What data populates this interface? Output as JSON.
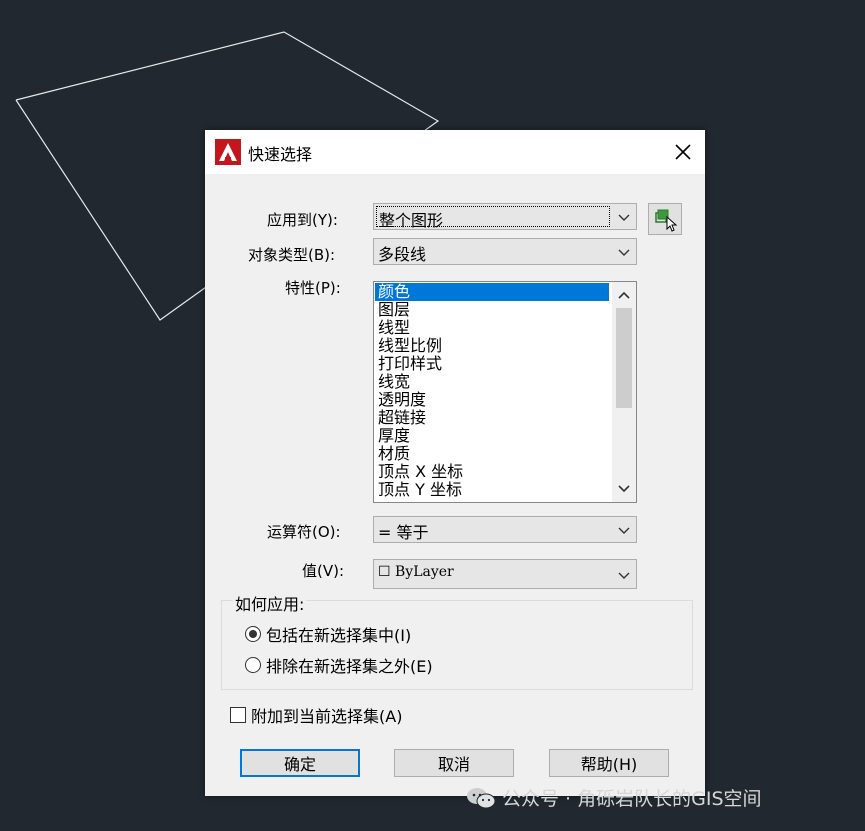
{
  "dialog": {
    "title": "快速选择",
    "close_glyph": "✕"
  },
  "form": {
    "apply_to_label": "应用到(Y):",
    "apply_to_value": "整个图形",
    "object_type_label": "对象类型(B):",
    "object_type_value": "多段线",
    "properties_label": "特性(P):",
    "properties": [
      "颜色",
      "图层",
      "线型",
      "线型比例",
      "打印样式",
      "线宽",
      "透明度",
      "超链接",
      "厚度",
      "材质",
      "顶点 X 坐标",
      "顶点 Y 坐标"
    ],
    "selected_property_index": 0,
    "operator_label": "运算符(O):",
    "operator_value": "= 等于",
    "value_label": "值(V):",
    "value_swatch": "☐",
    "value_value": "ByLayer"
  },
  "how_to_apply": {
    "title": "如何应用:",
    "include_label": "包括在新选择集中(I)",
    "exclude_label": "排除在新选择集之外(E)",
    "selected": "include"
  },
  "append_label": "附加到当前选择集(A)",
  "buttons": {
    "ok": "确定",
    "cancel": "取消",
    "help": "帮助(H)"
  },
  "watermark": {
    "text": "公众号 · 角砾岩队长的GIS空间"
  },
  "icons": {
    "app": "autocad-logo-icon",
    "close": "close-icon",
    "select_objects": "select-objects-icon",
    "watermark": "wechat-icon"
  },
  "colors": {
    "background": "#212830",
    "selection": "#0078d7",
    "app_red": "#c4161c"
  }
}
